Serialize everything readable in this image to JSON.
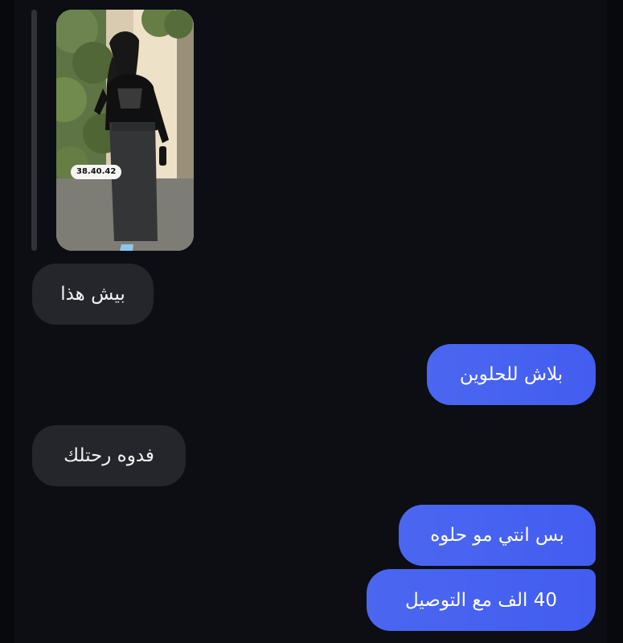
{
  "conversation": {
    "image_message": {
      "size_tag": "38.40.42"
    },
    "messages": [
      {
        "text": "بيش هذا",
        "side": "incoming"
      },
      {
        "text": "بلاش للحلوين",
        "side": "outgoing"
      },
      {
        "text": "فدوه رحتلك",
        "side": "incoming"
      },
      {
        "text": "بس انتي مو حلوه",
        "side": "outgoing"
      },
      {
        "text": "40 الف مع التوصيل",
        "side": "outgoing"
      }
    ]
  },
  "colors": {
    "background": "#0c0e13",
    "incoming_bubble": "#25262b",
    "outgoing_bubble": "#4b67f0",
    "text": "#ffffff"
  }
}
